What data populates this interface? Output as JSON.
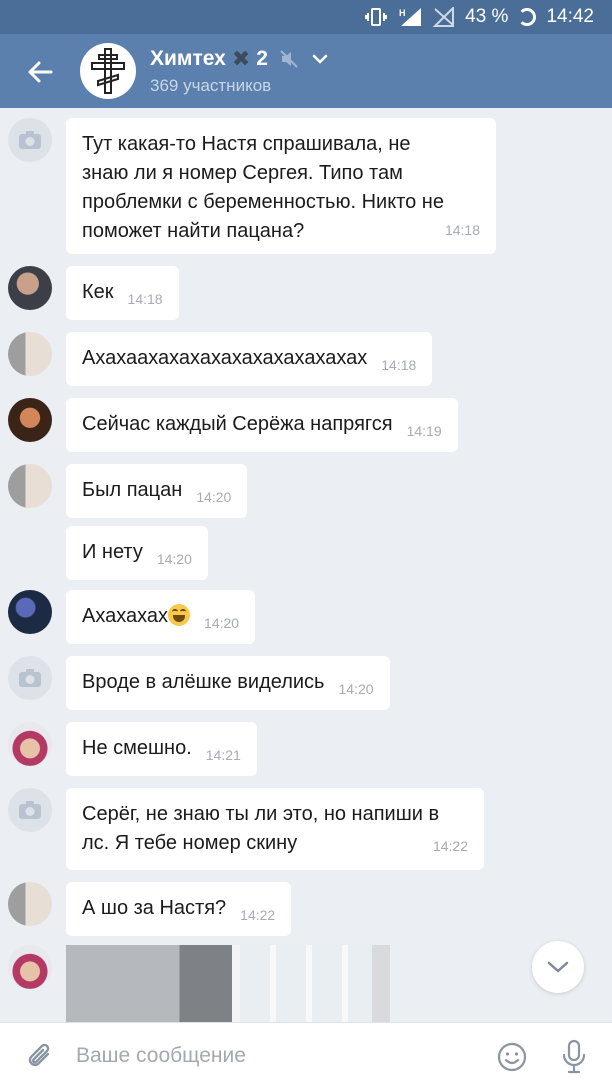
{
  "status_bar": {
    "network": "H",
    "battery": "43 %",
    "time": "14:42"
  },
  "header": {
    "title": "Химтех",
    "title_suffix": "✖",
    "title_number": "2",
    "subtitle": "369 участников"
  },
  "messages": [
    {
      "avatar": "camera-placeholder",
      "text": "Тут какая-то Настя спрашивала, не\nзнаю ли я номер Сергея. Типо там\nпроблемки с беременностью. Никто не\nпоможет найти пацана?",
      "time": "14:18"
    },
    {
      "avatar": "user-1",
      "text": "Кек",
      "time": "14:18"
    },
    {
      "avatar": "user-2",
      "text": "Ахахаахахахахахахахахахахах",
      "time": "14:18"
    },
    {
      "avatar": "user-3",
      "text": "Сейчас каждый Серёжа напрягся",
      "time": "14:19"
    },
    {
      "avatar": "user-2",
      "text": "Был пацан",
      "time": "14:20"
    },
    {
      "avatar": "",
      "text": "И нету",
      "time": "14:20"
    },
    {
      "avatar": "user-4",
      "text": "Ахахахах",
      "time": "14:20"
    },
    {
      "avatar": "camera-placeholder",
      "text": "Вроде в алёшке виделись",
      "time": "14:20"
    },
    {
      "avatar": "user-5",
      "text": "Не смешно.",
      "time": "14:21"
    },
    {
      "avatar": "camera-placeholder",
      "text": "Серёг, не знаю ты ли это, но напиши в\nлс. Я тебе номер скину",
      "time": "14:22"
    },
    {
      "avatar": "user-2",
      "text": "А шо за Настя?",
      "time": "14:22"
    }
  ],
  "composer": {
    "placeholder": "Ваше сообщение"
  },
  "colors": {
    "header_bg": "#5b80ad",
    "status_bg": "#4a6e98",
    "chat_bg": "#ebeef2",
    "bubble_bg": "#ffffff"
  }
}
